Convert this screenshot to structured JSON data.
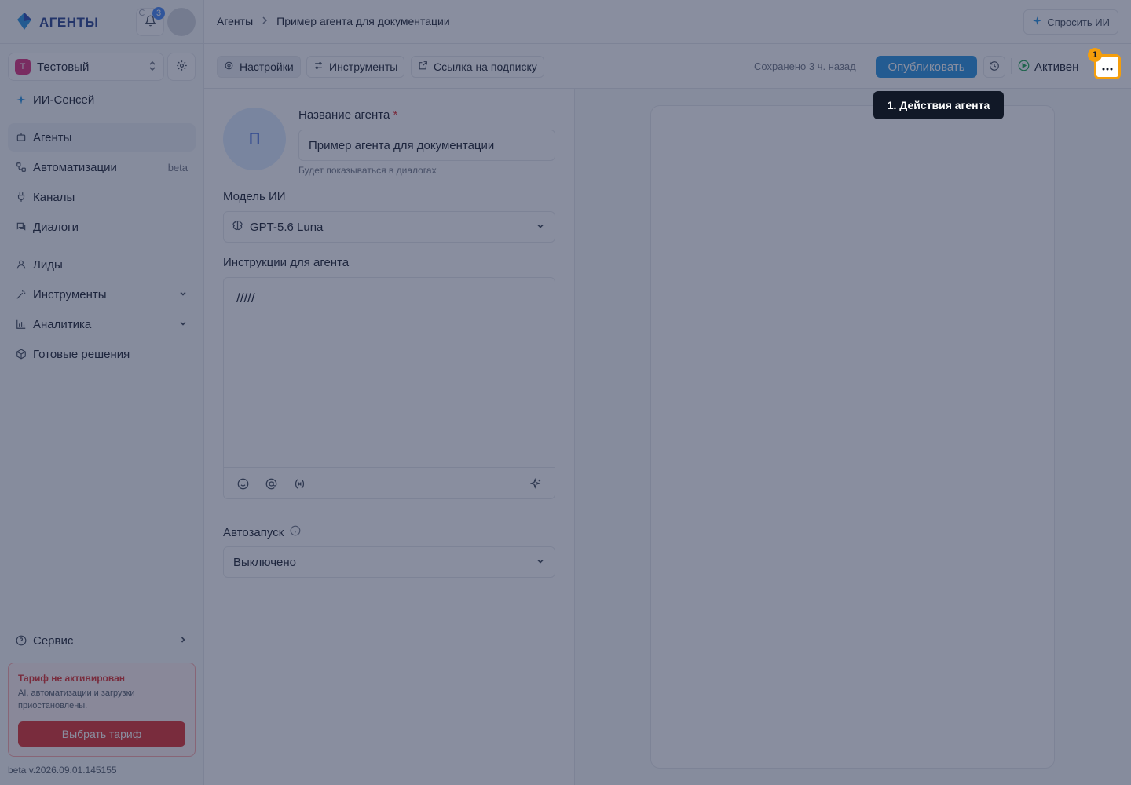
{
  "app": {
    "name": "АГЕНТЫ",
    "notifications_count": "3"
  },
  "workspace": {
    "initial": "Т",
    "name": "Тестовый"
  },
  "sidebar": {
    "items": [
      {
        "label": "ИИ-Сенсей",
        "icon": "sparkle-icon"
      },
      {
        "label": "Агенты",
        "icon": "bot-icon",
        "active": true
      },
      {
        "label": "Автоматизации",
        "icon": "workflow-icon",
        "tag": "beta"
      },
      {
        "label": "Каналы",
        "icon": "plug-icon"
      },
      {
        "label": "Диалоги",
        "icon": "chat-icon"
      },
      {
        "label": "Лиды",
        "icon": "user-icon"
      },
      {
        "label": "Инструменты",
        "icon": "wand-icon"
      },
      {
        "label": "Аналитика",
        "icon": "bar-chart-icon"
      },
      {
        "label": "Готовые решения",
        "icon": "box-icon"
      }
    ],
    "service_label": "Сервис",
    "trial": {
      "title": "Тариф не активирован",
      "text": "AI, автоматизации и загрузки приостановлены.",
      "button": "Выбрать тариф"
    },
    "version": "beta v.2026.09.01.145155"
  },
  "header": {
    "breadcrumb_root": "Агенты",
    "breadcrumb_current": "Пример агента для документации",
    "ask_ai": "Спросить ИИ"
  },
  "toolbar": {
    "tabs": [
      "Настройки",
      "Инструменты",
      "Ссылка на подписку"
    ],
    "saved_text": "Сохранено 3 ч. назад",
    "publish": "Опубликовать",
    "status": "Активен",
    "step_number": "1"
  },
  "form": {
    "avatar_letter": "П",
    "name_label": "Название агента",
    "required_mark": "*",
    "name_value": "Пример агента для документации",
    "name_hint": "Будет показываться в диалогах",
    "model_label": "Модель ИИ",
    "model_value": "GPT-5.6 Luna",
    "instructions_label": "Инструкции для агента",
    "instructions_value": "/////",
    "autostart_label": "Автозапуск",
    "autostart_value": "Выключено"
  },
  "tooltip": {
    "text": "1. Действия агента"
  },
  "colors": {
    "accent": "#1d8fe1",
    "highlight": "#f59e0b",
    "danger": "#dc2626",
    "workspace_badge": "#db2777"
  }
}
